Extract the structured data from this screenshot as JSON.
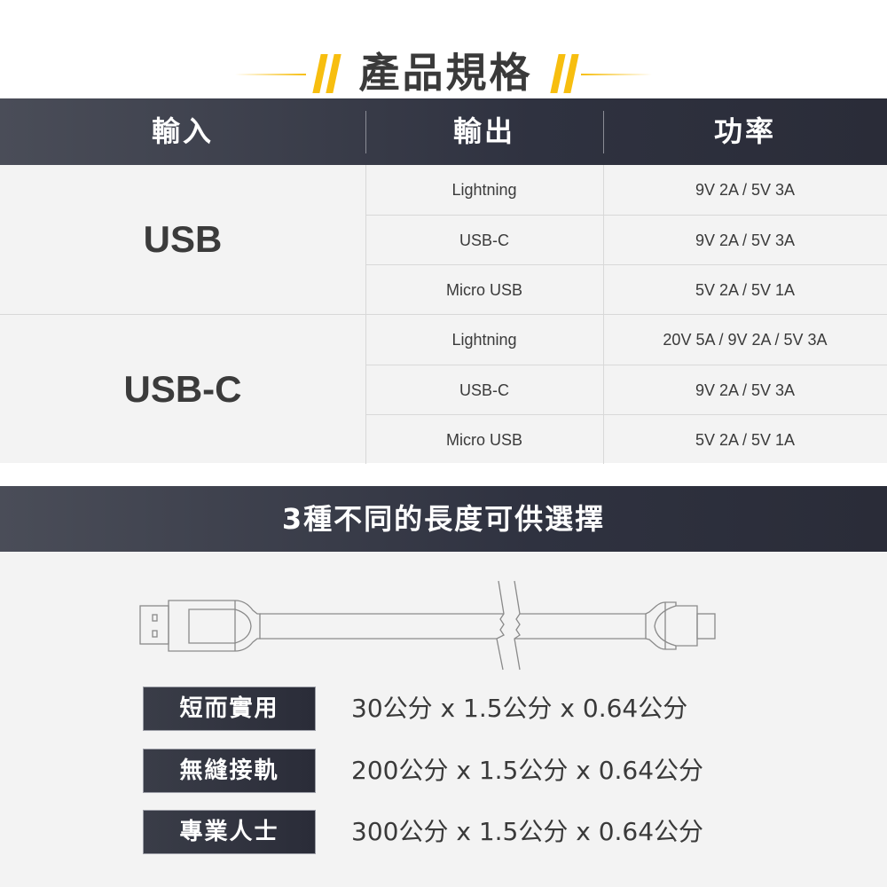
{
  "title": "產品規格",
  "colors": {
    "accent": "#f7be0f",
    "dark_header": "#2f3240",
    "row_bg": "#f3f3f3"
  },
  "table": {
    "headers": [
      "輸入",
      "輸出",
      "功率"
    ],
    "groups": [
      {
        "input": "USB",
        "rows": [
          {
            "output": "Lightning",
            "power": "9V 2A / 5V 3A"
          },
          {
            "output": "USB-C",
            "power": "9V 2A / 5V 3A"
          },
          {
            "output": "Micro USB",
            "power": "5V 2A / 5V 1A"
          }
        ]
      },
      {
        "input": "USB-C",
        "rows": [
          {
            "output": "Lightning",
            "power": "20V 5A / 9V 2A / 5V 3A"
          },
          {
            "output": "USB-C",
            "power": "9V 2A / 5V 3A"
          },
          {
            "output": "Micro USB",
            "power": "5V 2A / 5V 1A"
          }
        ]
      }
    ]
  },
  "lengths_section": {
    "banner": "3種不同的長度可供選擇",
    "illustration": "usb-cable-illustration",
    "options": [
      {
        "label": "短而實用",
        "size": "30公分 x 1.5公分 x 0.64公分"
      },
      {
        "label": "無縫接軌",
        "size": "200公分 x 1.5公分 x 0.64公分"
      },
      {
        "label": "專業人士",
        "size": "300公分 x 1.5公分 x 0.64公分"
      }
    ]
  }
}
